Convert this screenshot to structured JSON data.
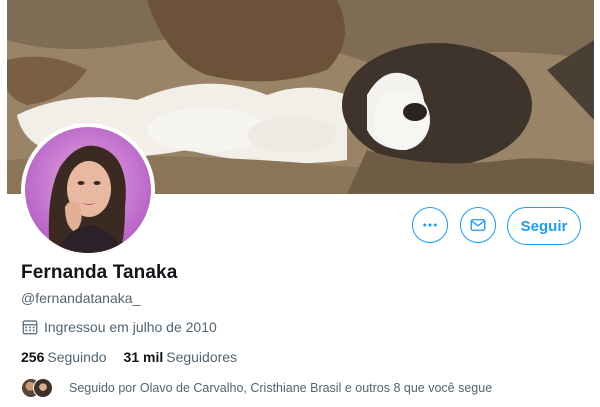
{
  "profile": {
    "name": "Fernanda Tanaka",
    "handle": "@fernandatanaka_",
    "joined": "Ingressou em julho de 2010",
    "following_count": "256",
    "following_label": "Seguindo",
    "followers_count": "31 mil",
    "followers_label": "Seguidores",
    "followed_by": "Seguido por Olavo de Carvalho, Cristhiane Brasil e outros 8 que você segue"
  },
  "actions": {
    "follow_label": "Seguir"
  },
  "icons": {
    "more": "more-horizontal-icon",
    "message": "envelope-icon",
    "calendar": "calendar-icon"
  },
  "colors": {
    "accent": "#1d9bf0",
    "secondary_text": "#536471",
    "primary_text": "#0f1419"
  }
}
